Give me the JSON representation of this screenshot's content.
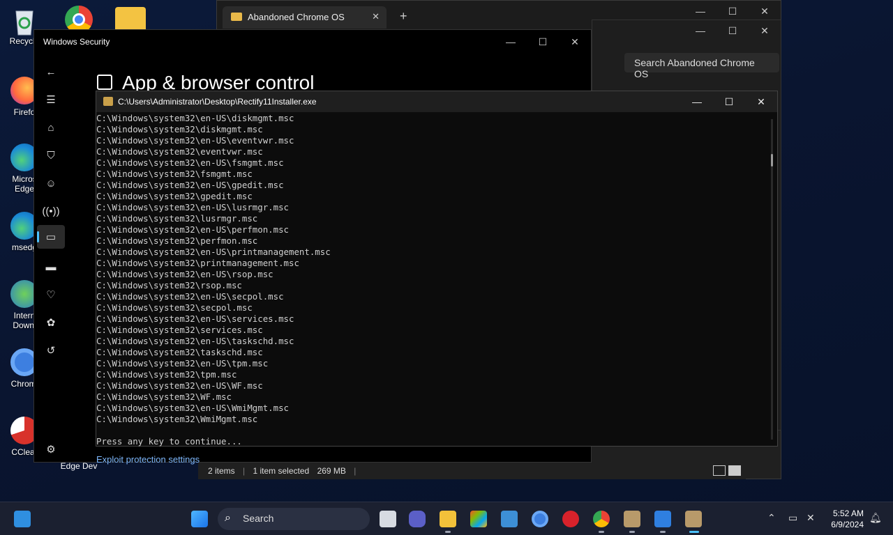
{
  "desktop_icons": [
    {
      "label": "Recycle",
      "icon": "recycle-bin-icon"
    },
    {
      "label": "Firefo",
      "icon": "firefox-icon"
    },
    {
      "label": "Micros Edge",
      "icon": "edge-icon"
    },
    {
      "label": "msedg",
      "icon": "edge-icon"
    },
    {
      "label": "Intern Downl",
      "icon": "idm-icon"
    },
    {
      "label": "Chromi",
      "icon": "chromium-icon"
    },
    {
      "label": "CClear",
      "icon": "ccleaner-icon"
    },
    {
      "label": "Edge Dev",
      "icon": "edge-dev-icon"
    }
  ],
  "explorer": {
    "tab_title": "Abandoned Chrome OS",
    "search_placeholder": "Search Abandoned Chrome OS",
    "status": {
      "items": "2 items",
      "selected": "1 item selected",
      "size": "269 MB",
      "separator": "|"
    }
  },
  "security": {
    "window_title": "Windows Security",
    "heading": "App & browser control",
    "exploit_link": "Exploit protection settings"
  },
  "console": {
    "title": "C:\\Users\\Administrator\\Desktop\\Rectify11Installer.exe",
    "lines": [
      "C:\\Windows\\system32\\en-US\\diskmgmt.msc",
      "C:\\Windows\\system32\\diskmgmt.msc",
      "C:\\Windows\\system32\\en-US\\eventvwr.msc",
      "C:\\Windows\\system32\\eventvwr.msc",
      "C:\\Windows\\system32\\en-US\\fsmgmt.msc",
      "C:\\Windows\\system32\\fsmgmt.msc",
      "C:\\Windows\\system32\\en-US\\gpedit.msc",
      "C:\\Windows\\system32\\gpedit.msc",
      "C:\\Windows\\system32\\en-US\\lusrmgr.msc",
      "C:\\Windows\\system32\\lusrmgr.msc",
      "C:\\Windows\\system32\\en-US\\perfmon.msc",
      "C:\\Windows\\system32\\perfmon.msc",
      "C:\\Windows\\system32\\en-US\\printmanagement.msc",
      "C:\\Windows\\system32\\printmanagement.msc",
      "C:\\Windows\\system32\\en-US\\rsop.msc",
      "C:\\Windows\\system32\\rsop.msc",
      "C:\\Windows\\system32\\en-US\\secpol.msc",
      "C:\\Windows\\system32\\secpol.msc",
      "C:\\Windows\\system32\\en-US\\services.msc",
      "C:\\Windows\\system32\\services.msc",
      "C:\\Windows\\system32\\en-US\\taskschd.msc",
      "C:\\Windows\\system32\\taskschd.msc",
      "C:\\Windows\\system32\\en-US\\tpm.msc",
      "C:\\Windows\\system32\\tpm.msc",
      "C:\\Windows\\system32\\en-US\\WF.msc",
      "C:\\Windows\\system32\\WF.msc",
      "C:\\Windows\\system32\\en-US\\WmiMgmt.msc",
      "C:\\Windows\\system32\\WmiMgmt.msc",
      "",
      "Press any key to continue..."
    ]
  },
  "taskbar": {
    "search_label": "Search",
    "time": "5:52 AM",
    "date": "6/9/2024"
  },
  "colors": {
    "accent": "#4cc2ff",
    "link": "#7fb9ff",
    "console_bg": "#0c0c0c"
  }
}
